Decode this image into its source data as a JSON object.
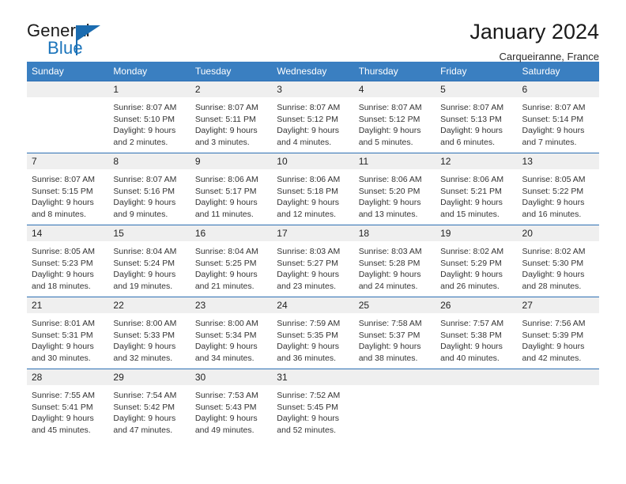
{
  "brand": {
    "word_one": "General",
    "word_two": "Blue",
    "logo_icon": "triangle-flag-icon"
  },
  "header": {
    "title": "January 2024",
    "subtitle": "Carqueiranne, France"
  },
  "calendar": {
    "weekday_headers": [
      "Sunday",
      "Monday",
      "Tuesday",
      "Wednesday",
      "Thursday",
      "Friday",
      "Saturday"
    ],
    "accent_color": "#3a7fc1",
    "rule_color": "#2d6fb3",
    "daynum_band_color": "#efefef",
    "weeks": [
      [
        {
          "day": "",
          "lines": []
        },
        {
          "day": "1",
          "lines": [
            "Sunrise: 8:07 AM",
            "Sunset: 5:10 PM",
            "Daylight: 9 hours",
            "and 2 minutes."
          ]
        },
        {
          "day": "2",
          "lines": [
            "Sunrise: 8:07 AM",
            "Sunset: 5:11 PM",
            "Daylight: 9 hours",
            "and 3 minutes."
          ]
        },
        {
          "day": "3",
          "lines": [
            "Sunrise: 8:07 AM",
            "Sunset: 5:12 PM",
            "Daylight: 9 hours",
            "and 4 minutes."
          ]
        },
        {
          "day": "4",
          "lines": [
            "Sunrise: 8:07 AM",
            "Sunset: 5:12 PM",
            "Daylight: 9 hours",
            "and 5 minutes."
          ]
        },
        {
          "day": "5",
          "lines": [
            "Sunrise: 8:07 AM",
            "Sunset: 5:13 PM",
            "Daylight: 9 hours",
            "and 6 minutes."
          ]
        },
        {
          "day": "6",
          "lines": [
            "Sunrise: 8:07 AM",
            "Sunset: 5:14 PM",
            "Daylight: 9 hours",
            "and 7 minutes."
          ]
        }
      ],
      [
        {
          "day": "7",
          "lines": [
            "Sunrise: 8:07 AM",
            "Sunset: 5:15 PM",
            "Daylight: 9 hours",
            "and 8 minutes."
          ]
        },
        {
          "day": "8",
          "lines": [
            "Sunrise: 8:07 AM",
            "Sunset: 5:16 PM",
            "Daylight: 9 hours",
            "and 9 minutes."
          ]
        },
        {
          "day": "9",
          "lines": [
            "Sunrise: 8:06 AM",
            "Sunset: 5:17 PM",
            "Daylight: 9 hours",
            "and 11 minutes."
          ]
        },
        {
          "day": "10",
          "lines": [
            "Sunrise: 8:06 AM",
            "Sunset: 5:18 PM",
            "Daylight: 9 hours",
            "and 12 minutes."
          ]
        },
        {
          "day": "11",
          "lines": [
            "Sunrise: 8:06 AM",
            "Sunset: 5:20 PM",
            "Daylight: 9 hours",
            "and 13 minutes."
          ]
        },
        {
          "day": "12",
          "lines": [
            "Sunrise: 8:06 AM",
            "Sunset: 5:21 PM",
            "Daylight: 9 hours",
            "and 15 minutes."
          ]
        },
        {
          "day": "13",
          "lines": [
            "Sunrise: 8:05 AM",
            "Sunset: 5:22 PM",
            "Daylight: 9 hours",
            "and 16 minutes."
          ]
        }
      ],
      [
        {
          "day": "14",
          "lines": [
            "Sunrise: 8:05 AM",
            "Sunset: 5:23 PM",
            "Daylight: 9 hours",
            "and 18 minutes."
          ]
        },
        {
          "day": "15",
          "lines": [
            "Sunrise: 8:04 AM",
            "Sunset: 5:24 PM",
            "Daylight: 9 hours",
            "and 19 minutes."
          ]
        },
        {
          "day": "16",
          "lines": [
            "Sunrise: 8:04 AM",
            "Sunset: 5:25 PM",
            "Daylight: 9 hours",
            "and 21 minutes."
          ]
        },
        {
          "day": "17",
          "lines": [
            "Sunrise: 8:03 AM",
            "Sunset: 5:27 PM",
            "Daylight: 9 hours",
            "and 23 minutes."
          ]
        },
        {
          "day": "18",
          "lines": [
            "Sunrise: 8:03 AM",
            "Sunset: 5:28 PM",
            "Daylight: 9 hours",
            "and 24 minutes."
          ]
        },
        {
          "day": "19",
          "lines": [
            "Sunrise: 8:02 AM",
            "Sunset: 5:29 PM",
            "Daylight: 9 hours",
            "and 26 minutes."
          ]
        },
        {
          "day": "20",
          "lines": [
            "Sunrise: 8:02 AM",
            "Sunset: 5:30 PM",
            "Daylight: 9 hours",
            "and 28 minutes."
          ]
        }
      ],
      [
        {
          "day": "21",
          "lines": [
            "Sunrise: 8:01 AM",
            "Sunset: 5:31 PM",
            "Daylight: 9 hours",
            "and 30 minutes."
          ]
        },
        {
          "day": "22",
          "lines": [
            "Sunrise: 8:00 AM",
            "Sunset: 5:33 PM",
            "Daylight: 9 hours",
            "and 32 minutes."
          ]
        },
        {
          "day": "23",
          "lines": [
            "Sunrise: 8:00 AM",
            "Sunset: 5:34 PM",
            "Daylight: 9 hours",
            "and 34 minutes."
          ]
        },
        {
          "day": "24",
          "lines": [
            "Sunrise: 7:59 AM",
            "Sunset: 5:35 PM",
            "Daylight: 9 hours",
            "and 36 minutes."
          ]
        },
        {
          "day": "25",
          "lines": [
            "Sunrise: 7:58 AM",
            "Sunset: 5:37 PM",
            "Daylight: 9 hours",
            "and 38 minutes."
          ]
        },
        {
          "day": "26",
          "lines": [
            "Sunrise: 7:57 AM",
            "Sunset: 5:38 PM",
            "Daylight: 9 hours",
            "and 40 minutes."
          ]
        },
        {
          "day": "27",
          "lines": [
            "Sunrise: 7:56 AM",
            "Sunset: 5:39 PM",
            "Daylight: 9 hours",
            "and 42 minutes."
          ]
        }
      ],
      [
        {
          "day": "28",
          "lines": [
            "Sunrise: 7:55 AM",
            "Sunset: 5:41 PM",
            "Daylight: 9 hours",
            "and 45 minutes."
          ]
        },
        {
          "day": "29",
          "lines": [
            "Sunrise: 7:54 AM",
            "Sunset: 5:42 PM",
            "Daylight: 9 hours",
            "and 47 minutes."
          ]
        },
        {
          "day": "30",
          "lines": [
            "Sunrise: 7:53 AM",
            "Sunset: 5:43 PM",
            "Daylight: 9 hours",
            "and 49 minutes."
          ]
        },
        {
          "day": "31",
          "lines": [
            "Sunrise: 7:52 AM",
            "Sunset: 5:45 PM",
            "Daylight: 9 hours",
            "and 52 minutes."
          ]
        },
        {
          "day": "",
          "lines": []
        },
        {
          "day": "",
          "lines": []
        },
        {
          "day": "",
          "lines": []
        }
      ]
    ]
  }
}
